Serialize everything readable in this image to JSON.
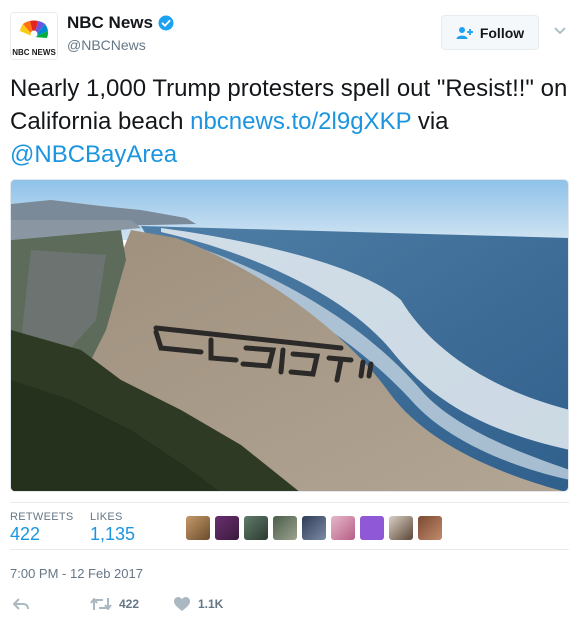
{
  "account": {
    "display_name": "NBC News",
    "handle": "@NBCNews",
    "verified": true,
    "avatar_text": "NBC NEWS"
  },
  "follow_label": "Follow",
  "tweet": {
    "text_part1": "Nearly 1,000 Trump protesters spell out \"Resist!!\" on California beach ",
    "link": "nbcnews.to/2l9gXKP",
    "text_part2": " via ",
    "mention": "@NBCBayArea"
  },
  "stats": {
    "retweets_label": "RETWEETS",
    "retweets_value": "422",
    "likes_label": "LIKES",
    "likes_value": "1,135"
  },
  "timestamp": "7:00 PM - 12 Feb 2017",
  "actions": {
    "retweet_count": "422",
    "like_count": "1.1K"
  },
  "colors": {
    "link": "#1b95e0",
    "secondary_text": "#657786",
    "verified": "#1da1f2"
  },
  "likers": [
    "liker-avatar-1",
    "liker-avatar-2",
    "liker-avatar-3",
    "liker-avatar-4",
    "liker-avatar-5",
    "liker-avatar-6",
    "liker-avatar-7",
    "liker-avatar-8",
    "liker-avatar-9",
    "liker-avatar-10"
  ]
}
